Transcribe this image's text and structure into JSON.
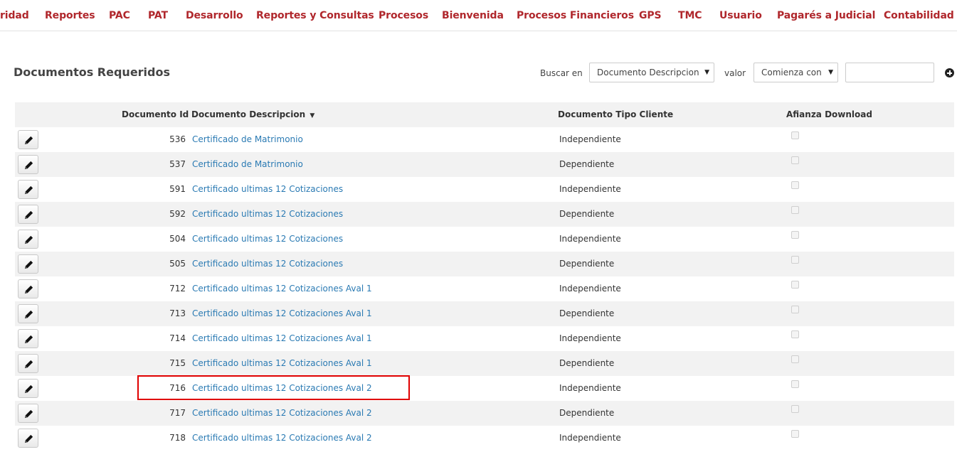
{
  "nav": [
    "ridad",
    "Reportes",
    "PAC",
    "PAT",
    "Desarrollo",
    "Reportes y Consultas",
    "Procesos",
    "Bienvenida",
    "Procesos Financieros",
    "GPS",
    "TMC",
    "Usuario",
    "Pagarés a Judicial",
    "Contabilidad"
  ],
  "page_title": "Documentos Requeridos",
  "search": {
    "buscar_label": "Buscar en",
    "buscar_value": "Documento Descripcion",
    "valor_label": "valor",
    "valor_value": "Comienza con",
    "text_value": ""
  },
  "table": {
    "headers": {
      "id": "Documento Id",
      "desc": "Documento Descripcion",
      "tipo": "Documento Tipo Cliente",
      "afianza": "Afianza Download"
    },
    "rows": [
      {
        "id": "536",
        "desc": "Certificado de Matrimonio",
        "tipo": "Independiente",
        "afianza": false
      },
      {
        "id": "537",
        "desc": "Certificado de Matrimonio",
        "tipo": "Dependiente",
        "afianza": false
      },
      {
        "id": "591",
        "desc": "Certificado ultimas 12 Cotizaciones",
        "tipo": "Independiente",
        "afianza": false
      },
      {
        "id": "592",
        "desc": "Certificado ultimas 12 Cotizaciones",
        "tipo": "Dependiente",
        "afianza": false
      },
      {
        "id": "504",
        "desc": "Certificado ultimas 12 Cotizaciones",
        "tipo": "Independiente",
        "afianza": false
      },
      {
        "id": "505",
        "desc": "Certificado ultimas 12 Cotizaciones",
        "tipo": "Dependiente",
        "afianza": false
      },
      {
        "id": "712",
        "desc": "Certificado ultimas 12 Cotizaciones Aval 1",
        "tipo": "Independiente",
        "afianza": false
      },
      {
        "id": "713",
        "desc": "Certificado ultimas 12 Cotizaciones Aval 1",
        "tipo": "Dependiente",
        "afianza": false
      },
      {
        "id": "714",
        "desc": "Certificado ultimas 12 Cotizaciones Aval 1",
        "tipo": "Independiente",
        "afianza": false
      },
      {
        "id": "715",
        "desc": "Certificado ultimas 12 Cotizaciones Aval 1",
        "tipo": "Dependiente",
        "afianza": false
      },
      {
        "id": "716",
        "desc": "Certificado ultimas 12 Cotizaciones Aval 2",
        "tipo": "Independiente",
        "afianza": false
      },
      {
        "id": "717",
        "desc": "Certificado ultimas 12 Cotizaciones Aval 2",
        "tipo": "Dependiente",
        "afianza": false
      },
      {
        "id": "718",
        "desc": "Certificado ultimas 12 Cotizaciones Aval 2",
        "tipo": "Independiente",
        "afianza": false
      }
    ]
  },
  "colors": {
    "nav_text": "#b0272c",
    "link": "#2a7ab3",
    "highlight": "#e00000"
  }
}
